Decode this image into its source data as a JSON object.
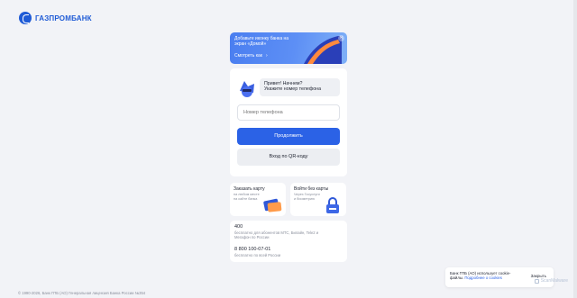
{
  "brand": {
    "name": "ГАЗПРОМБАНК",
    "color": "#1f5bd6"
  },
  "banner": {
    "title": "Добавьте иконку банка на экран «Домой»",
    "link": "Смотреть как",
    "close_icon": "close-icon"
  },
  "login": {
    "greeting_line1": "Привет! Начнем?",
    "greeting_line2": "Укажите номер телефона",
    "phone_placeholder": "Номер телефона",
    "continue_label": "Продолжить",
    "qr_label": "Вход по QR-коду"
  },
  "promo": {
    "card": {
      "title": "Заказать карту",
      "subtitle": "на любом месте на сайте банка"
    },
    "no_card": {
      "title": "Войти без карты",
      "subtitle": "Через Госуслуги и биометрию"
    }
  },
  "contacts": [
    {
      "number": "400",
      "desc": "бесплатно для абонентов МТС, Билайн, Tele2 и Мегафон по России"
    },
    {
      "number": "8 800 100-07-01",
      "desc": "бесплатно по всей России"
    }
  ],
  "footer": {
    "text": "© 1990-2026, Банк ГПБ (АО) Генеральная лицензия Банка России №354"
  },
  "cookie": {
    "text": "Банк ГПБ (АО) использует cookie-файлы.",
    "link": "Подробнее о cookies",
    "close": "Закрыть"
  },
  "watermark": "ScanMalware",
  "colors": {
    "primary": "#2b62e6",
    "background": "#f2f3f7"
  }
}
